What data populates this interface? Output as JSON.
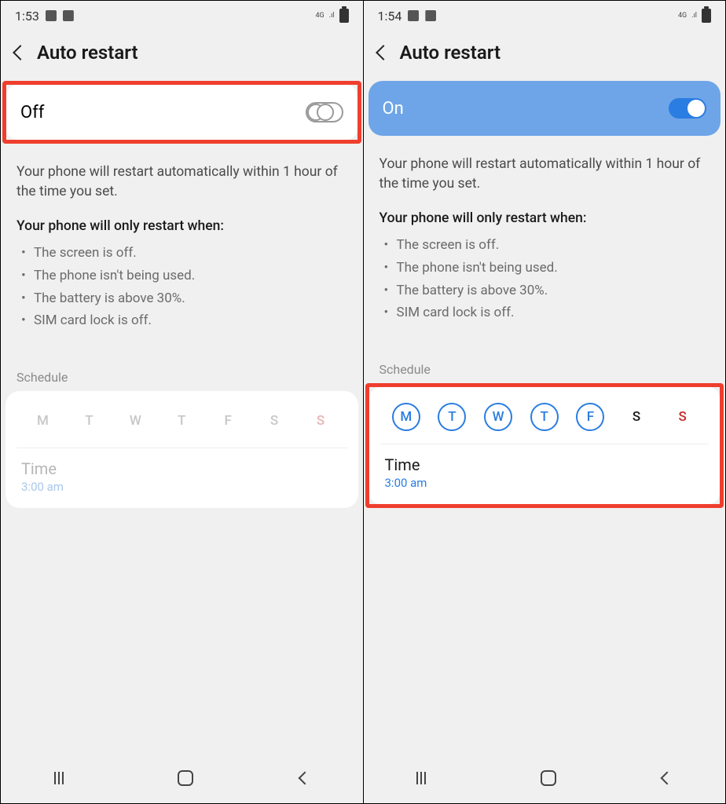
{
  "left": {
    "status": {
      "time": "1:53",
      "net": "4G"
    },
    "title": "Auto restart",
    "toggle": {
      "label": "Off",
      "on": false
    },
    "description": "Your phone will restart automatically within 1 hour of the time you set.",
    "conditions_title": "Your phone will only restart when:",
    "conditions": [
      "The screen is off.",
      "The phone isn't being used.",
      "The battery is above 30%.",
      "SIM card lock is off."
    ],
    "schedule_label": "Schedule",
    "days": [
      {
        "letter": "M",
        "selected": false,
        "sunday": false
      },
      {
        "letter": "T",
        "selected": false,
        "sunday": false
      },
      {
        "letter": "W",
        "selected": false,
        "sunday": false
      },
      {
        "letter": "T",
        "selected": false,
        "sunday": false
      },
      {
        "letter": "F",
        "selected": false,
        "sunday": false
      },
      {
        "letter": "S",
        "selected": false,
        "sunday": false
      },
      {
        "letter": "S",
        "selected": false,
        "sunday": true
      }
    ],
    "time_label": "Time",
    "time_value": "3:00 am"
  },
  "right": {
    "status": {
      "time": "1:54",
      "net": "4G"
    },
    "title": "Auto restart",
    "toggle": {
      "label": "On",
      "on": true
    },
    "description": "Your phone will restart automatically within 1 hour of the time you set.",
    "conditions_title": "Your phone will only restart when:",
    "conditions": [
      "The screen is off.",
      "The phone isn't being used.",
      "The battery is above 30%.",
      "SIM card lock is off."
    ],
    "schedule_label": "Schedule",
    "days": [
      {
        "letter": "M",
        "selected": true,
        "sunday": false
      },
      {
        "letter": "T",
        "selected": true,
        "sunday": false
      },
      {
        "letter": "W",
        "selected": true,
        "sunday": false
      },
      {
        "letter": "T",
        "selected": true,
        "sunday": false
      },
      {
        "letter": "F",
        "selected": true,
        "sunday": false
      },
      {
        "letter": "S",
        "selected": false,
        "sunday": false
      },
      {
        "letter": "S",
        "selected": false,
        "sunday": true
      }
    ],
    "time_label": "Time",
    "time_value": "3:00 am"
  }
}
